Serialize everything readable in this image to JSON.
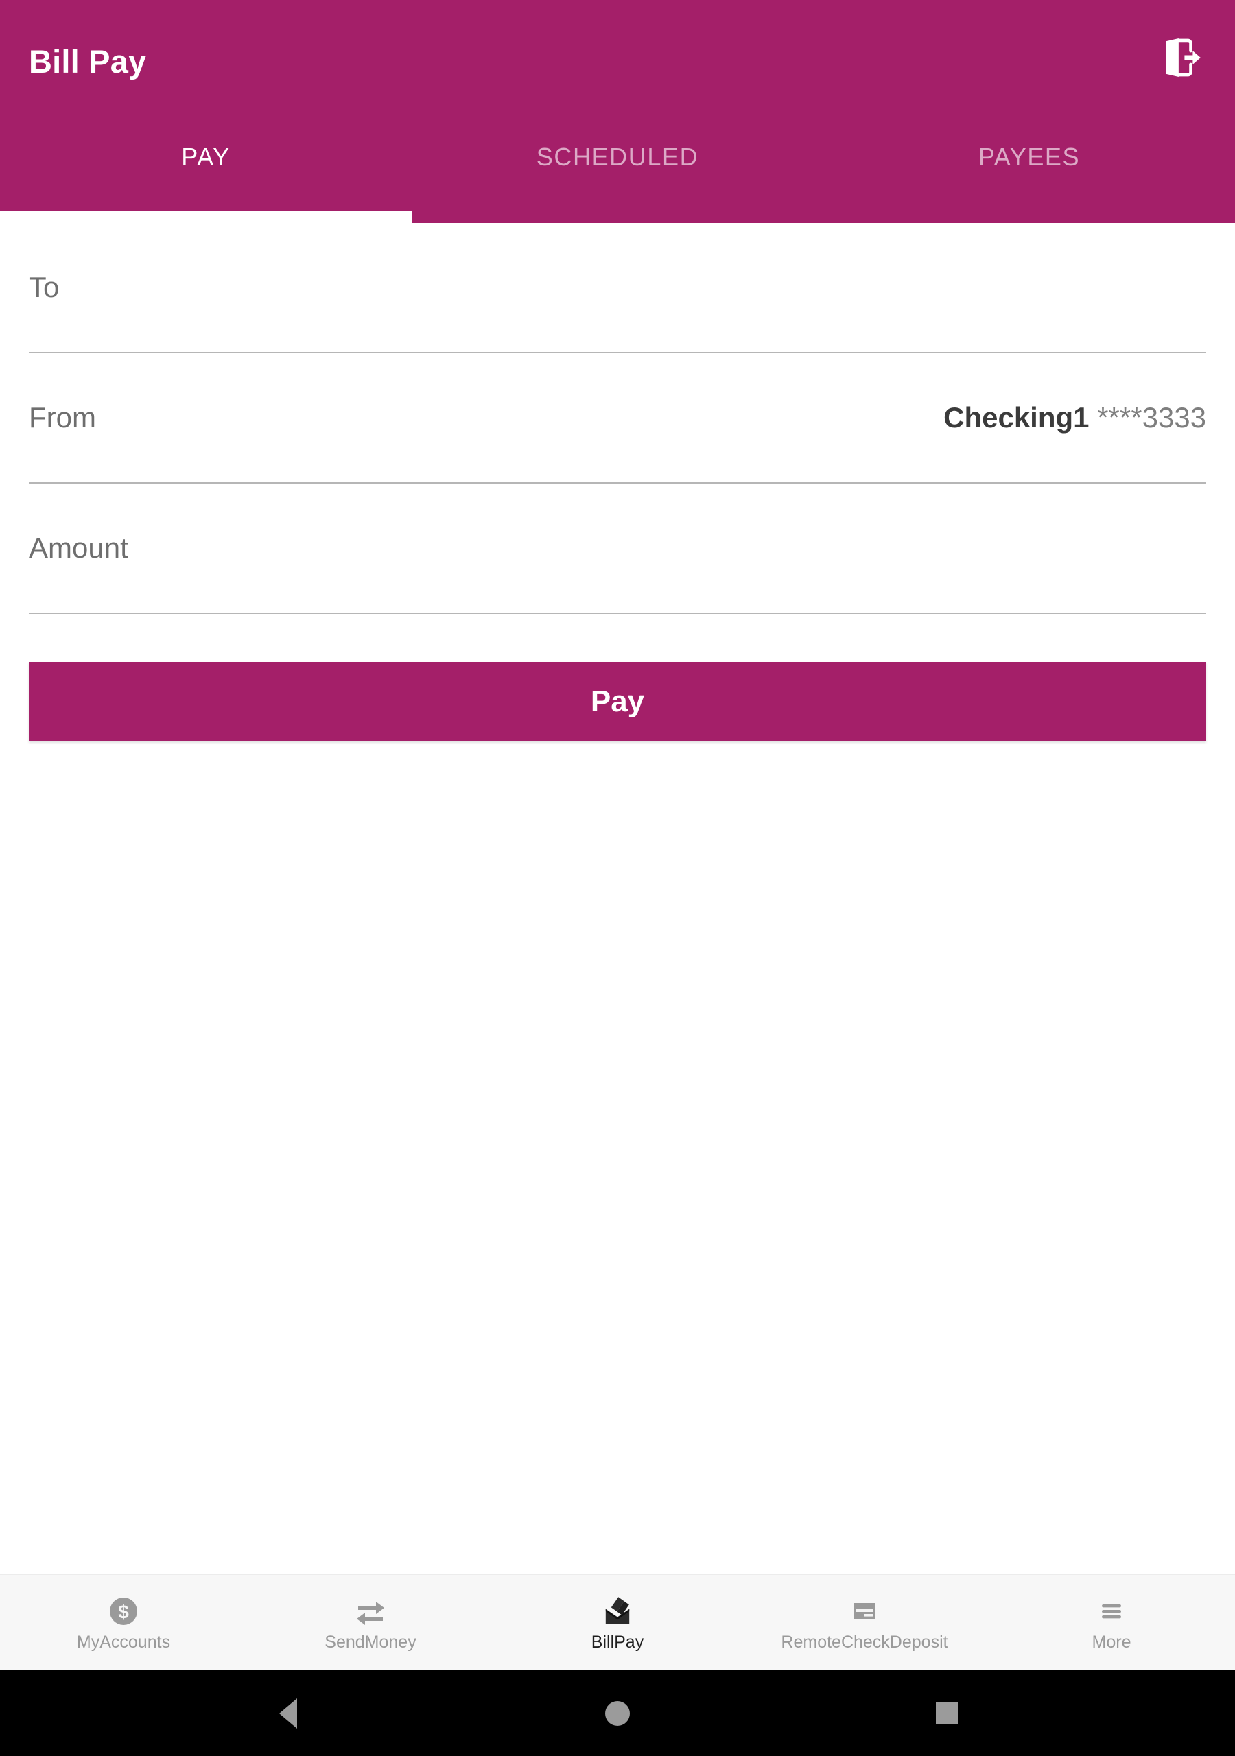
{
  "app": {
    "title": "Bill Pay",
    "accent_color": "#a41f69",
    "logout_icon": "logout-door-arrow-icon"
  },
  "tabs": [
    {
      "label": "PAY",
      "active": true
    },
    {
      "label": "SCHEDULED",
      "active": false
    },
    {
      "label": "PAYEES",
      "active": false
    }
  ],
  "form": {
    "to": {
      "label": "To",
      "value": "",
      "placeholder": "To"
    },
    "from": {
      "label": "From",
      "account_name": "Checking1",
      "account_mask": "****3333"
    },
    "amount": {
      "label": "Amount",
      "value": "",
      "placeholder": "Amount"
    },
    "submit_label": "Pay"
  },
  "bottom_nav": [
    {
      "label": "MyAccounts",
      "icon": "dollar-circle-icon",
      "active": false
    },
    {
      "label": "SendMoney",
      "icon": "transfer-arrows-icon",
      "active": false
    },
    {
      "label": "BillPay",
      "icon": "envelope-check-icon",
      "active": true
    },
    {
      "label": "RemoteCheckDeposit",
      "icon": "check-card-icon",
      "active": false
    },
    {
      "label": "More",
      "icon": "hamburger-menu-icon",
      "active": false
    }
  ],
  "system_nav": [
    {
      "name": "back",
      "icon": "triangle-back-icon"
    },
    {
      "name": "home",
      "icon": "circle-home-icon"
    },
    {
      "name": "recents",
      "icon": "square-recents-icon"
    }
  ]
}
